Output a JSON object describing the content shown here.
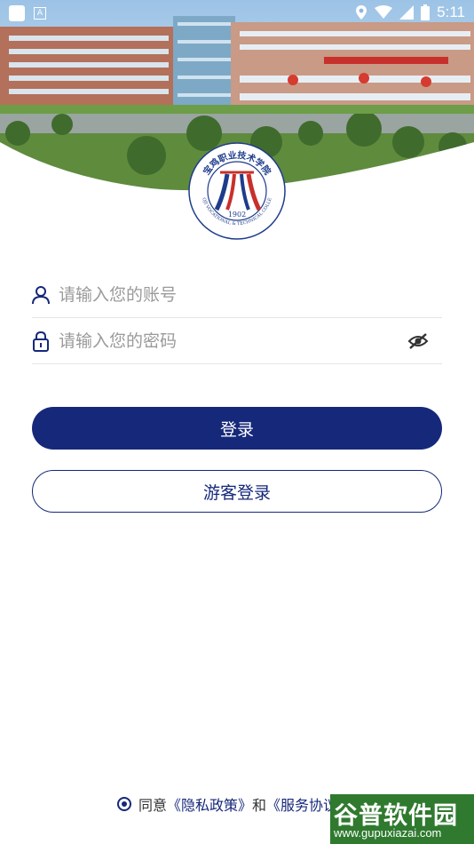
{
  "status_bar": {
    "time": "5:11",
    "a_label": "A"
  },
  "logo": {
    "name": "宝鸡职业技术学院",
    "year": "1902",
    "english": "BAOJI VOCATIONAL & TECHNICAL COLLEGE"
  },
  "form": {
    "account_placeholder": "请输入您的账号",
    "password_placeholder": "请输入您的密码"
  },
  "buttons": {
    "login": "登录",
    "guest_login": "游客登录"
  },
  "agreement": {
    "prefix": "同意",
    "privacy_link": "《隐私政策》",
    "and": "和",
    "service_link": "《服务协议》"
  },
  "watermark": {
    "title": "谷普软件园",
    "url": "www.gupuxiazai.com"
  },
  "colors": {
    "primary": "#16287a",
    "watermark": "#2f7a2f"
  }
}
